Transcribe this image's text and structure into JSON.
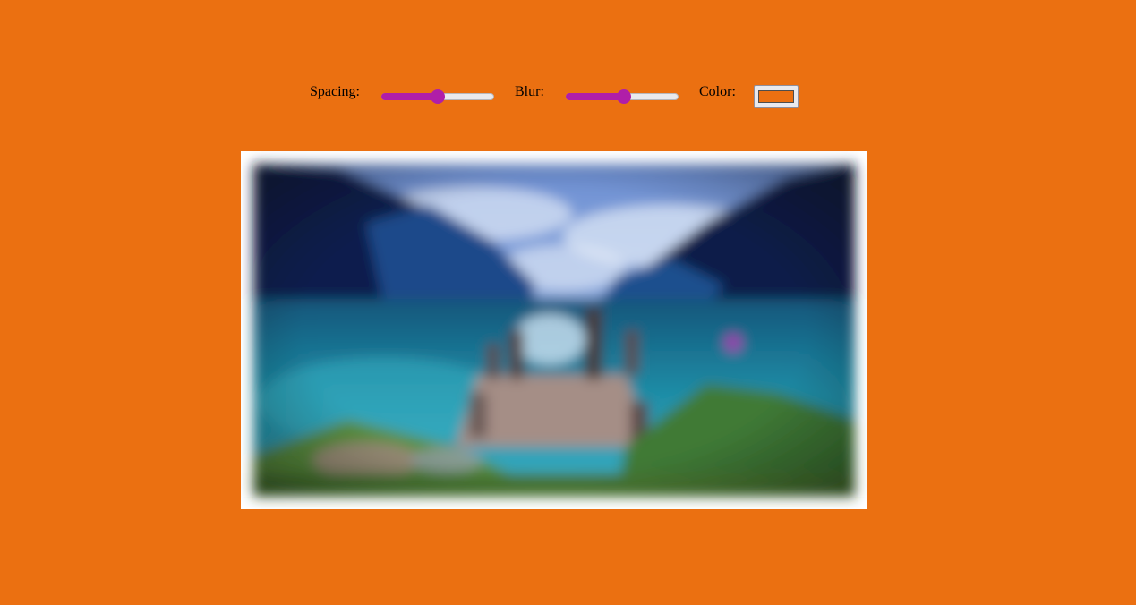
{
  "controls": {
    "spacing": {
      "label": "Spacing:",
      "value_fraction": 0.5
    },
    "blur": {
      "label": "Blur:",
      "value_fraction": 0.52
    },
    "color": {
      "label": "Color:",
      "value": "#eb7011"
    },
    "slider_accent": "#b01ea8"
  },
  "page": {
    "background": "#eb7011"
  },
  "image": {
    "name": "mountain-lake-dock-photo",
    "frame_color": "#ffffff"
  }
}
